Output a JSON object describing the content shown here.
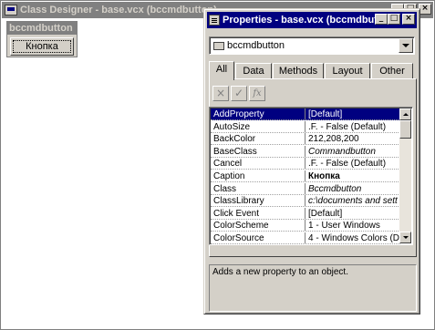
{
  "class_designer": {
    "title": "Class Designer - base.vcx (bccmdbutton)",
    "window_buttons": [
      "_",
      "□",
      "×"
    ]
  },
  "design_surface": {
    "form_title": "bccmdbutton",
    "button_caption": "Кнопка"
  },
  "properties": {
    "title": "Properties - base.vcx (bccmdbutton)",
    "window_buttons": [
      "_",
      "□",
      "×"
    ],
    "object": "bccmdbutton",
    "tabs": [
      {
        "label": "All",
        "active": true
      },
      {
        "label": "Data",
        "active": false
      },
      {
        "label": "Methods",
        "active": false
      },
      {
        "label": "Layout",
        "active": false
      },
      {
        "label": "Other",
        "active": false
      }
    ],
    "tools": [
      "×",
      "✓",
      "fx"
    ],
    "rows": [
      {
        "name": "AddProperty",
        "value": "[Default]",
        "selected": true,
        "style": ""
      },
      {
        "name": "AutoSize",
        "value": ".F. - False (Default)",
        "selected": false,
        "style": ""
      },
      {
        "name": "BackColor",
        "value": "212,208,200",
        "selected": false,
        "style": ""
      },
      {
        "name": "BaseClass",
        "value": "Commandbutton",
        "selected": false,
        "style": "ital"
      },
      {
        "name": "Cancel",
        "value": ".F. - False (Default)",
        "selected": false,
        "style": ""
      },
      {
        "name": "Caption",
        "value": "Кнопка",
        "selected": false,
        "style": "bold"
      },
      {
        "name": "Class",
        "value": "Bccmdbutton",
        "selected": false,
        "style": "ital"
      },
      {
        "name": "ClassLibrary",
        "value": "c:\\documents and sett",
        "selected": false,
        "style": "ital"
      },
      {
        "name": "Click Event",
        "value": "[Default]",
        "selected": false,
        "style": ""
      },
      {
        "name": "ColorScheme",
        "value": "1 - User Windows",
        "selected": false,
        "style": ""
      },
      {
        "name": "ColorSource",
        "value": "4 - Windows Colors (De",
        "selected": false,
        "style": ""
      }
    ],
    "description": "Adds a new property to an object."
  }
}
